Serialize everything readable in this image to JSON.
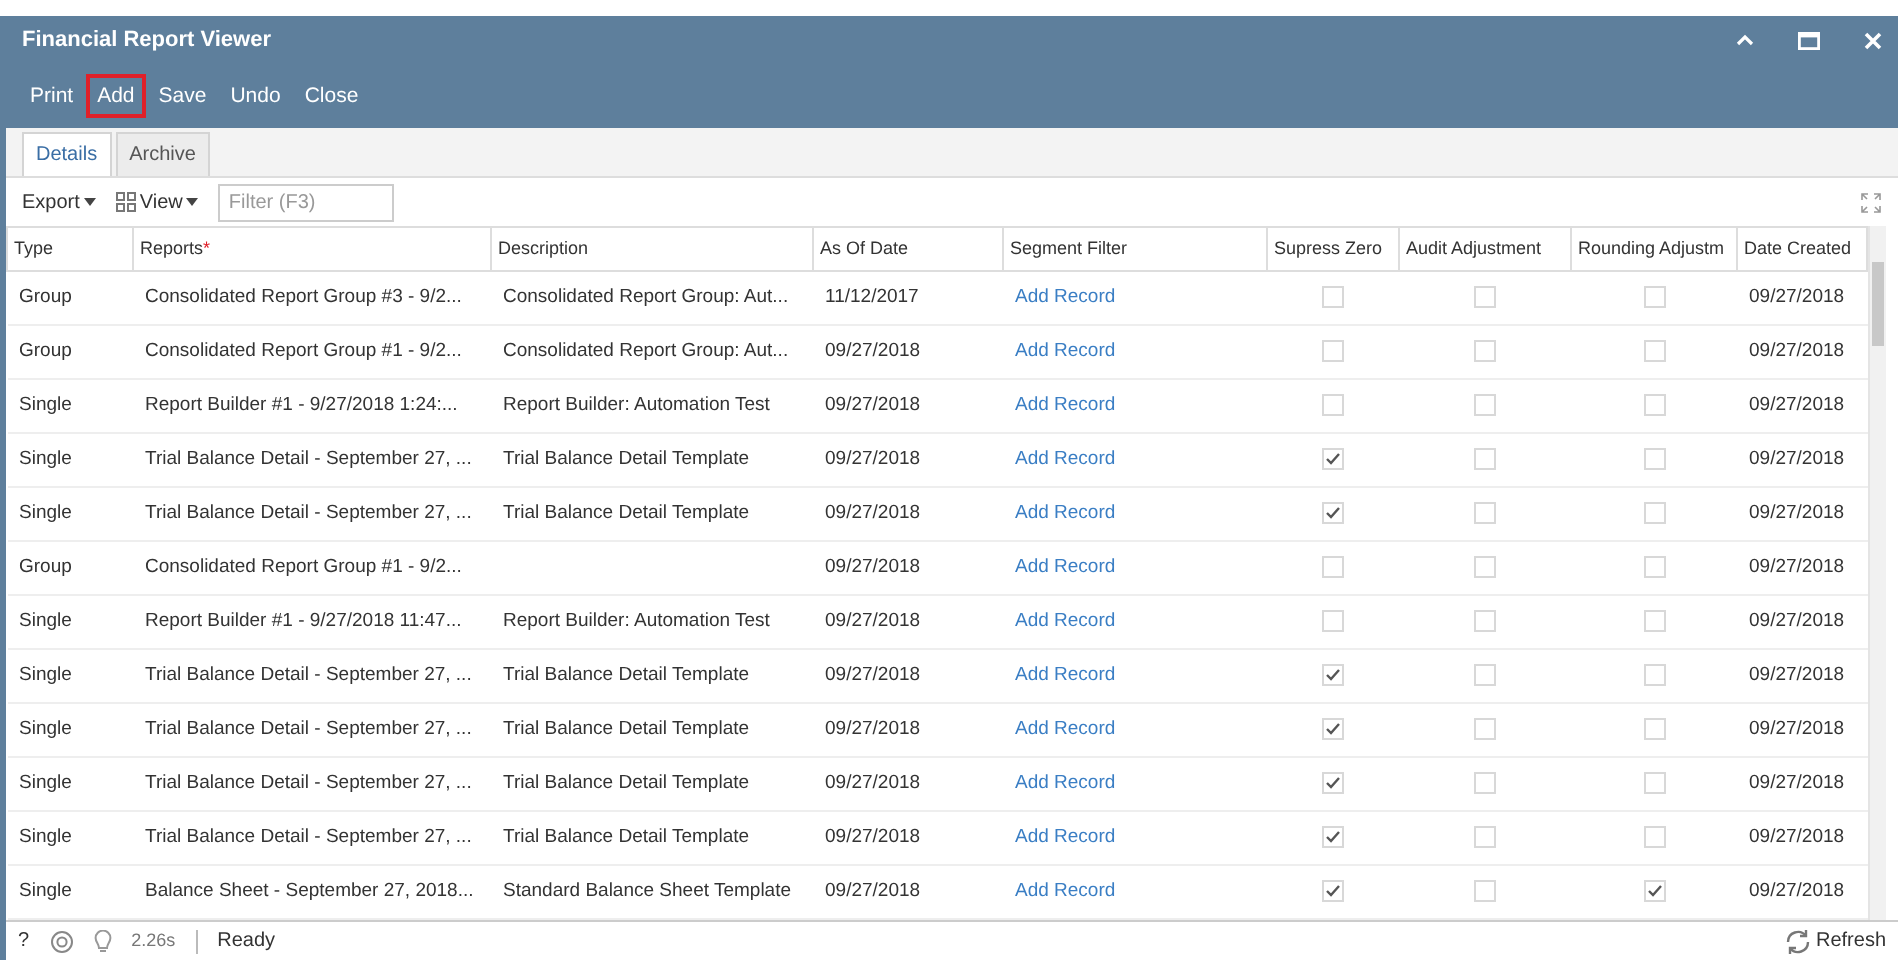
{
  "window": {
    "title": "Financial Report Viewer"
  },
  "toolbar": [
    {
      "label": "Print",
      "highlighted": false
    },
    {
      "label": "Add",
      "highlighted": true
    },
    {
      "label": "Save",
      "highlighted": false
    },
    {
      "label": "Undo",
      "highlighted": false
    },
    {
      "label": "Close",
      "highlighted": false
    }
  ],
  "tabs": [
    {
      "label": "Details",
      "selected": true
    },
    {
      "label": "Archive",
      "selected": false
    }
  ],
  "grid_toolbar": {
    "export": "Export",
    "view": "View",
    "filter": {
      "placeholder": "Filter (F3)"
    }
  },
  "table": {
    "columns": [
      {
        "label": "Type"
      },
      {
        "label": "Reports",
        "required_mark": "*"
      },
      {
        "label": "Description"
      },
      {
        "label": "As Of Date"
      },
      {
        "label": "Segment Filter"
      },
      {
        "label": "Supress Zero"
      },
      {
        "label": "Audit Adjustment"
      },
      {
        "label": "Rounding Adjustm"
      },
      {
        "label": "Date Created"
      }
    ],
    "rows": [
      {
        "type": "Group",
        "report": "Consolidated Report Group #3 - 9/2...",
        "description": "Consolidated Report Group: Aut...",
        "as_of_date": "11/12/2017",
        "segment_filter": "Add Record",
        "supress_zero": false,
        "audit_adjustment": false,
        "rounding_adjustment": false,
        "date_created": "09/27/2018"
      },
      {
        "type": "Group",
        "report": "Consolidated Report Group #1 - 9/2...",
        "description": "Consolidated Report Group: Aut...",
        "as_of_date": "09/27/2018",
        "segment_filter": "Add Record",
        "supress_zero": false,
        "audit_adjustment": false,
        "rounding_adjustment": false,
        "date_created": "09/27/2018"
      },
      {
        "type": "Single",
        "report": "Report Builder #1 - 9/27/2018 1:24:...",
        "description": "Report Builder: Automation Test",
        "as_of_date": "09/27/2018",
        "segment_filter": "Add Record",
        "supress_zero": false,
        "audit_adjustment": false,
        "rounding_adjustment": false,
        "date_created": "09/27/2018"
      },
      {
        "type": "Single",
        "report": "Trial Balance Detail - September 27, ...",
        "description": "Trial Balance Detail Template",
        "as_of_date": "09/27/2018",
        "segment_filter": "Add Record",
        "supress_zero": true,
        "audit_adjustment": false,
        "rounding_adjustment": false,
        "date_created": "09/27/2018"
      },
      {
        "type": "Single",
        "report": "Trial Balance Detail - September 27, ...",
        "description": "Trial Balance Detail Template",
        "as_of_date": "09/27/2018",
        "segment_filter": "Add Record",
        "supress_zero": true,
        "audit_adjustment": false,
        "rounding_adjustment": false,
        "date_created": "09/27/2018"
      },
      {
        "type": "Group",
        "report": "Consolidated Report Group #1 - 9/2...",
        "as_of_date": "09/27/2018",
        "segment_filter": "Add Record",
        "supress_zero": false,
        "audit_adjustment": false,
        "rounding_adjustment": false,
        "date_created": "09/27/2018"
      },
      {
        "type": "Single",
        "report": "Report Builder #1 - 9/27/2018 11:47...",
        "description": "Report Builder: Automation Test",
        "as_of_date": "09/27/2018",
        "segment_filter": "Add Record",
        "supress_zero": false,
        "audit_adjustment": false,
        "rounding_adjustment": false,
        "date_created": "09/27/2018"
      },
      {
        "type": "Single",
        "report": "Trial Balance Detail - September 27, ...",
        "description": "Trial Balance Detail Template",
        "as_of_date": "09/27/2018",
        "segment_filter": "Add Record",
        "supress_zero": true,
        "audit_adjustment": false,
        "rounding_adjustment": false,
        "date_created": "09/27/2018"
      },
      {
        "type": "Single",
        "report": "Trial Balance Detail - September 27, ...",
        "description": "Trial Balance Detail Template",
        "as_of_date": "09/27/2018",
        "segment_filter": "Add Record",
        "supress_zero": true,
        "audit_adjustment": false,
        "rounding_adjustment": false,
        "date_created": "09/27/2018"
      },
      {
        "type": "Single",
        "report": "Trial Balance Detail - September 27, ...",
        "description": "Trial Balance Detail Template",
        "as_of_date": "09/27/2018",
        "segment_filter": "Add Record",
        "supress_zero": true,
        "audit_adjustment": false,
        "rounding_adjustment": false,
        "date_created": "09/27/2018"
      },
      {
        "type": "Single",
        "report": "Trial Balance Detail - September 27, ...",
        "description": "Trial Balance Detail Template",
        "as_of_date": "09/27/2018",
        "segment_filter": "Add Record",
        "supress_zero": true,
        "audit_adjustment": false,
        "rounding_adjustment": false,
        "date_created": "09/27/2018"
      },
      {
        "type": "Single",
        "report": "Balance Sheet - September 27, 2018...",
        "description": "Standard Balance Sheet Template",
        "as_of_date": "09/27/2018",
        "segment_filter": "Add Record",
        "supress_zero": true,
        "audit_adjustment": false,
        "rounding_adjustment": true,
        "date_created": "09/27/2018"
      }
    ]
  },
  "status_bar": {
    "help": "?",
    "timing": "2.26s",
    "status": "Ready",
    "refresh": "Refresh"
  }
}
